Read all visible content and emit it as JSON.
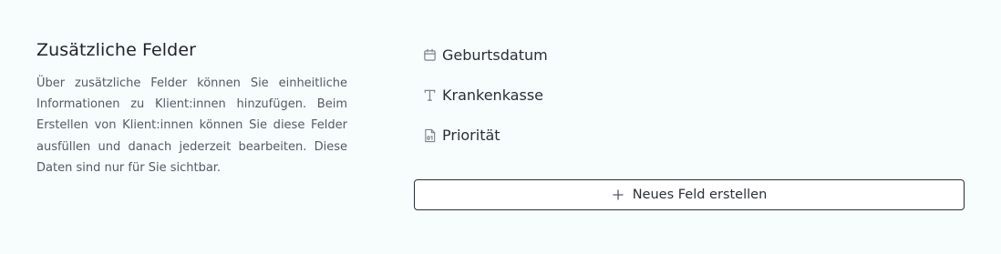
{
  "section": {
    "title": "Zusätzliche Felder",
    "description": "Über zusätzliche Felder können Sie einheitli­che Informationen zu Klient:innen hinzufü­gen. Beim Erstellen von Klient:innen können Sie diese Felder ausfüllen und danach jeder­zeit bearbeiten. Diese Daten sind nur für Sie sichtbar."
  },
  "fields": [
    {
      "label": "Geburtsdatum",
      "icon": "calendar-icon"
    },
    {
      "label": "Krankenkasse",
      "icon": "text-type-icon"
    },
    {
      "label": "Priorität",
      "icon": "number-file-icon"
    }
  ],
  "actions": {
    "new_field_label": "Neues Feld erstellen",
    "new_field_icon": "plus-icon"
  },
  "colors": {
    "background": "#f7fcfd",
    "text": "#2b2f36",
    "muted_text": "#555b63",
    "button_border": "#2b2f36"
  }
}
